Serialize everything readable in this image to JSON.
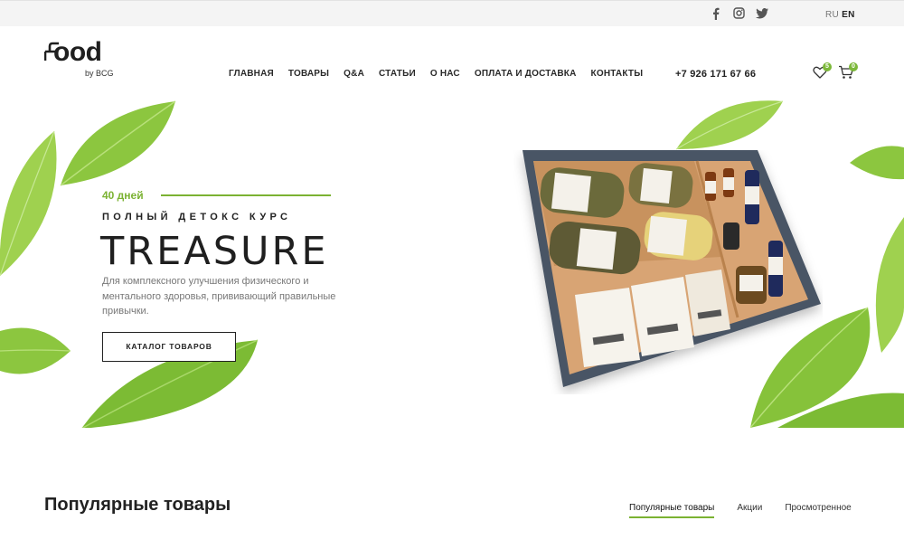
{
  "topbar": {
    "social": [
      {
        "icon": "facebook-icon"
      },
      {
        "icon": "instagram-icon"
      },
      {
        "icon": "twitter-icon"
      }
    ],
    "lang_ru": "RU",
    "lang_en": "EN"
  },
  "header": {
    "logo_word": "ood",
    "logo_sub": "by BCG",
    "nav": [
      "ГЛАВНАЯ",
      "ТОВАРЫ",
      "Q&A",
      "СТАТЬИ",
      "О НАС",
      "ОПЛАТА И ДОСТАВКА",
      "КОНТАКТЫ"
    ],
    "phone": "+7 926 171 67 66",
    "wishlist_count": "5",
    "cart_count": "0"
  },
  "hero": {
    "tag": "40 дней",
    "subtitle": "ПОЛНЫЙ ДЕТОКС КУРС",
    "title": "TREASURE",
    "description": "Для комплексного улучшения физического и ментального здоровья, прививающий правильные привычки.",
    "button": "КАТАЛОГ ТОВАРОВ"
  },
  "popular": {
    "title": "Популярные товары",
    "tabs": [
      "Популярные товары",
      "Акции",
      "Просмотренное"
    ]
  },
  "colors": {
    "accent": "#7bb232",
    "dark": "#1f1f1f",
    "box_border": "#4a5565",
    "kraft": "#d8a474"
  }
}
